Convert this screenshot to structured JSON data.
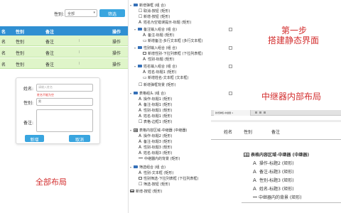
{
  "filter": {
    "label": "性别:",
    "select_value": "全部",
    "search_label": "筛选"
  },
  "table": {
    "headers": [
      "名",
      "性别",
      "备注",
      "操作"
    ],
    "rows": [
      {
        "name": "名",
        "gender": "性别",
        "note": "备注",
        "action": "操作"
      },
      {
        "name": "名",
        "gender": "性别",
        "note": "备注",
        "action": "操作"
      },
      {
        "name": "名",
        "gender": "性别",
        "note": "备注",
        "action": "操作"
      }
    ]
  },
  "form": {
    "name_label": "姓名:",
    "name_placeholder": "请输入姓名",
    "name_error": "姓名不能为空",
    "gender_label": "性别:",
    "gender_value": "男",
    "note_label": "备注:",
    "add_label": "新增",
    "cancel_label": "取消"
  },
  "captions": {
    "overall": "全部布局",
    "step1_line1": "第一步",
    "step1_line2": "搭建静态界面",
    "repeater": "中继器内部布局"
  },
  "tree": [
    "新增弹框 (组 合)",
    "取消-按钮 (矩形)",
    "新增-按钮 (矩形)",
    "姓名为空错误提示-标题 (矩形)",
    "备注输入组合 (组 合)",
    "备注-标题 (矩形)",
    "新增备注-多行文本框 (多行文本框)",
    "性别输入组合 (组 合)",
    "新增性别-下拉列表框 (下拉列表框)",
    "性别-标题 (矩形)",
    "姓名输入组合 (组 合)",
    "姓名-标题1 (矩形)",
    "新增姓名-文本框 (文本框)",
    "新增弹框背景 (矩形)",
    "表格组头 (组 合)",
    "操作-标题1 (矩形)",
    "备注-标题1 (矩形)",
    "性别-标题1 (矩形)",
    "姓名-标题1 (矩形)",
    "表格-边框1 (矩形)",
    "表格内容区域-中继器 (中继器)",
    "操作-标题2 (矩形)",
    "备注-标题3 (矩形)",
    "性别-标题3 (矩形)",
    "姓名-标题3 (矩形)",
    "中继器内的背景 (矩形)",
    "筛选组合 (组 合)",
    "性别-文本框 (矩形)",
    "性别筛选-下拉列表框 (下拉列表框)",
    "筛选-按钮 (矩形)",
    "新增-按钮 (矩形)"
  ],
  "zoom": {
    "tab_label": "新增弹框-中继器 ×",
    "headers": [
      "姓名",
      "性别",
      "备注"
    ],
    "nodes": [
      "表格内容区域-中继器 (中继器)",
      "操作-标题2 (矩形)",
      "备注-标题3 (矩形)",
      "性别-标题3 (矩形)",
      "姓名-标题3 (矩形)",
      "中继器内的背景 (矩形)"
    ]
  },
  "colors": {
    "accent": "#39a5df",
    "header_blue": "#2f8fd2",
    "row_green": "#dff5c9",
    "caption_red": "#d32f2f",
    "folder_blue": "#3570b8"
  }
}
